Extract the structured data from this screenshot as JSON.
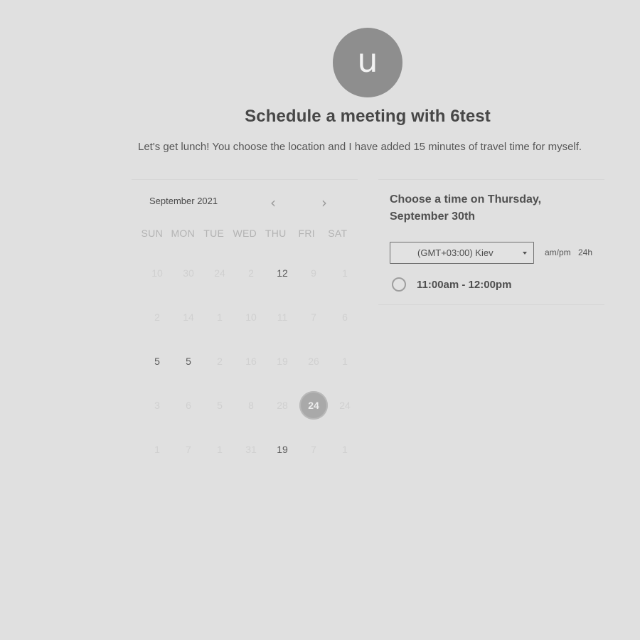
{
  "avatar": {
    "initial": "u"
  },
  "header": {
    "title": "Schedule a meeting with 6test",
    "description": "Let's get lunch! You choose the location and I have added 15 minutes of travel time for myself."
  },
  "calendar": {
    "month_label": "September 2021",
    "prev_icon": "chevron-left-icon",
    "next_icon": "chevron-right-icon",
    "weekdays": [
      "SUN",
      "MON",
      "TUE",
      "WED",
      "THU",
      "FRI",
      "SAT"
    ],
    "weeks": [
      [
        "10",
        "30",
        "24",
        "2",
        "12",
        "9",
        "1"
      ],
      [
        "2",
        "14",
        "1",
        "10",
        "11",
        "7",
        "6"
      ],
      [
        "5",
        "5",
        "2",
        "16",
        "19",
        "26",
        "1"
      ],
      [
        "3",
        "6",
        "5",
        "8",
        "28",
        "24",
        "24"
      ],
      [
        "1",
        "7",
        "1",
        "31",
        "19",
        "7",
        "1"
      ]
    ],
    "active_days": [
      [
        0,
        4
      ],
      [
        2,
        0
      ],
      [
        2,
        1
      ],
      [
        4,
        4
      ]
    ],
    "selected_day": [
      3,
      5
    ]
  },
  "time_panel": {
    "heading": "Choose a time on Thursday, September 30th",
    "timezone": "(GMT+03:00) Kiev",
    "format_ampm": "am/pm",
    "format_24h": "24h",
    "slots": [
      "11:00am - 12:00pm"
    ]
  }
}
